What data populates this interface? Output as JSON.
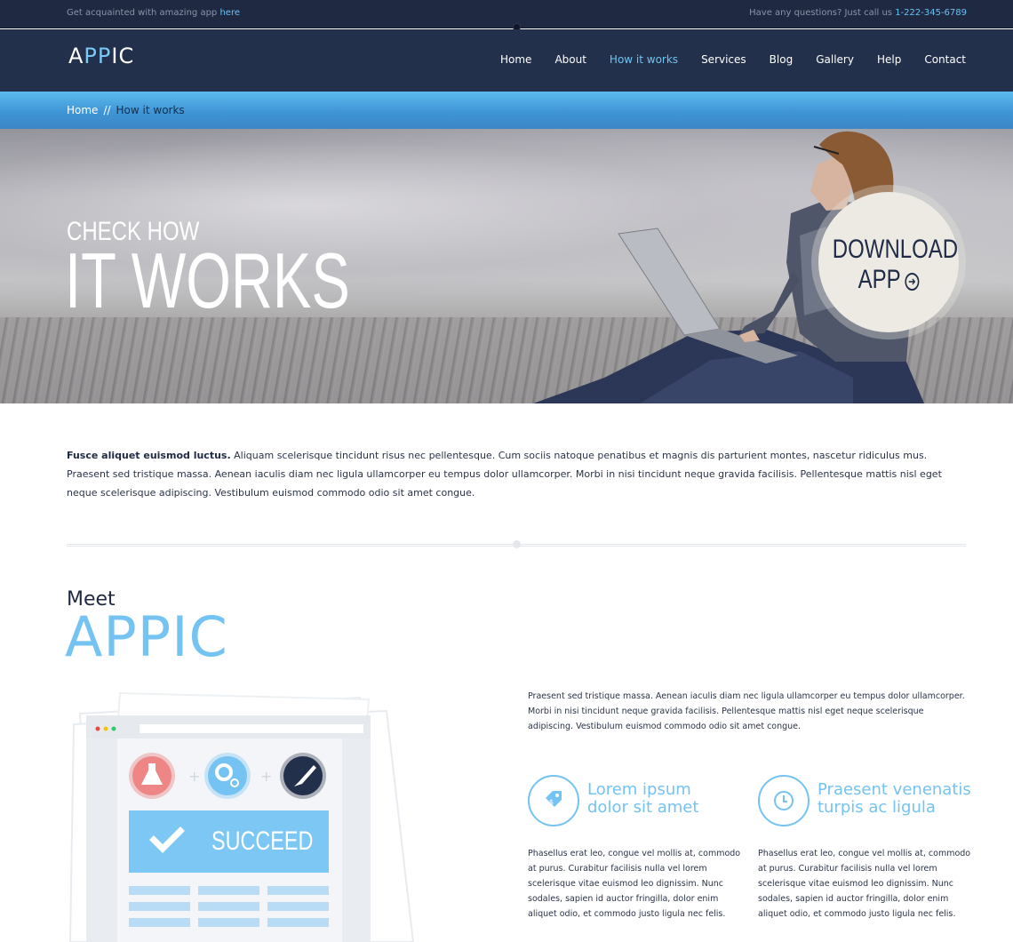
{
  "topbar": {
    "left_text": "Get acquainted with amazing app",
    "left_link": "here",
    "right_text": "Have any questions? Just call us",
    "phone": "1-222-345-6789"
  },
  "nav": {
    "logo_a": "A",
    "logo_pp": "PP",
    "logo_ic": "IC",
    "items": [
      {
        "label": "Home"
      },
      {
        "label": "About"
      },
      {
        "label": "How it works",
        "active": true
      },
      {
        "label": "Services"
      },
      {
        "label": "Blog"
      },
      {
        "label": "Gallery"
      },
      {
        "label": "Help"
      },
      {
        "label": "Contact"
      }
    ]
  },
  "breadcrumb": {
    "home": "Home",
    "separator": "//",
    "current": "How it works"
  },
  "hero": {
    "line1": "CHECK HOW",
    "line2": "IT WORKS",
    "download_line1": "DOWNLOAD",
    "download_line2": "APP"
  },
  "intro": {
    "bold": "Fusce aliquet euismod luctus.",
    "text": " Aliquam scelerisque tincidunt risus nec pellentesque. Cum sociis natoque penatibus et magnis dis parturient montes, nascetur ridiculus mus. Praesent sed tristique massa. Aenean iaculis diam nec ligula ullamcorper eu tempus dolor ullamcorper. Morbi in nisi tincidunt neque gravida facilisis.  Pellentesque mattis nisl eget neque scelerisque adipiscing. Vestibulum euismod commodo odio sit amet congue."
  },
  "meet": {
    "small": "Meet",
    "big": "APPIC"
  },
  "illustration": {
    "button_label": "SUCCEED"
  },
  "right": {
    "paragraph": "Praesent sed tristique massa. Aenean iaculis diam nec ligula ullamcorper eu tempus dolor ullamcorper. Morbi in nisi tincidunt neque gravida facilisis.  Pellentesque mattis nisl eget neque scelerisque adipiscing. Vestibulum euismod commodo odio sit amet congue.",
    "features": [
      {
        "title_l1": "Lorem ipsum",
        "title_l2": "dolor sit amet",
        "icon": "price-tag-icon",
        "body": "Phasellus erat leo, congue vel mollis at, commodo at purus. Curabitur facilisis nulla vel lorem scelerisque vitae euismod leo dignissim. Nunc sodales, sapien id auctor fringilla, dolor enim aliquet odio, et commodo justo ligula nec felis."
      },
      {
        "title_l1": "Praesent venenatis",
        "title_l2": "turpis ac ligula",
        "icon": "clock-icon",
        "body": "Phasellus erat leo, congue vel mollis at, commodo at purus. Curabitur facilisis nulla vel lorem scelerisque vitae euismod leo dignissim. Nunc sodales, sapien id auctor fringilla, dolor enim aliquet odio, et commodo justo ligula nec felis."
      }
    ]
  },
  "colors": {
    "navy": "#23304b",
    "accent": "#74c3f2",
    "cream": "#eceae2"
  }
}
